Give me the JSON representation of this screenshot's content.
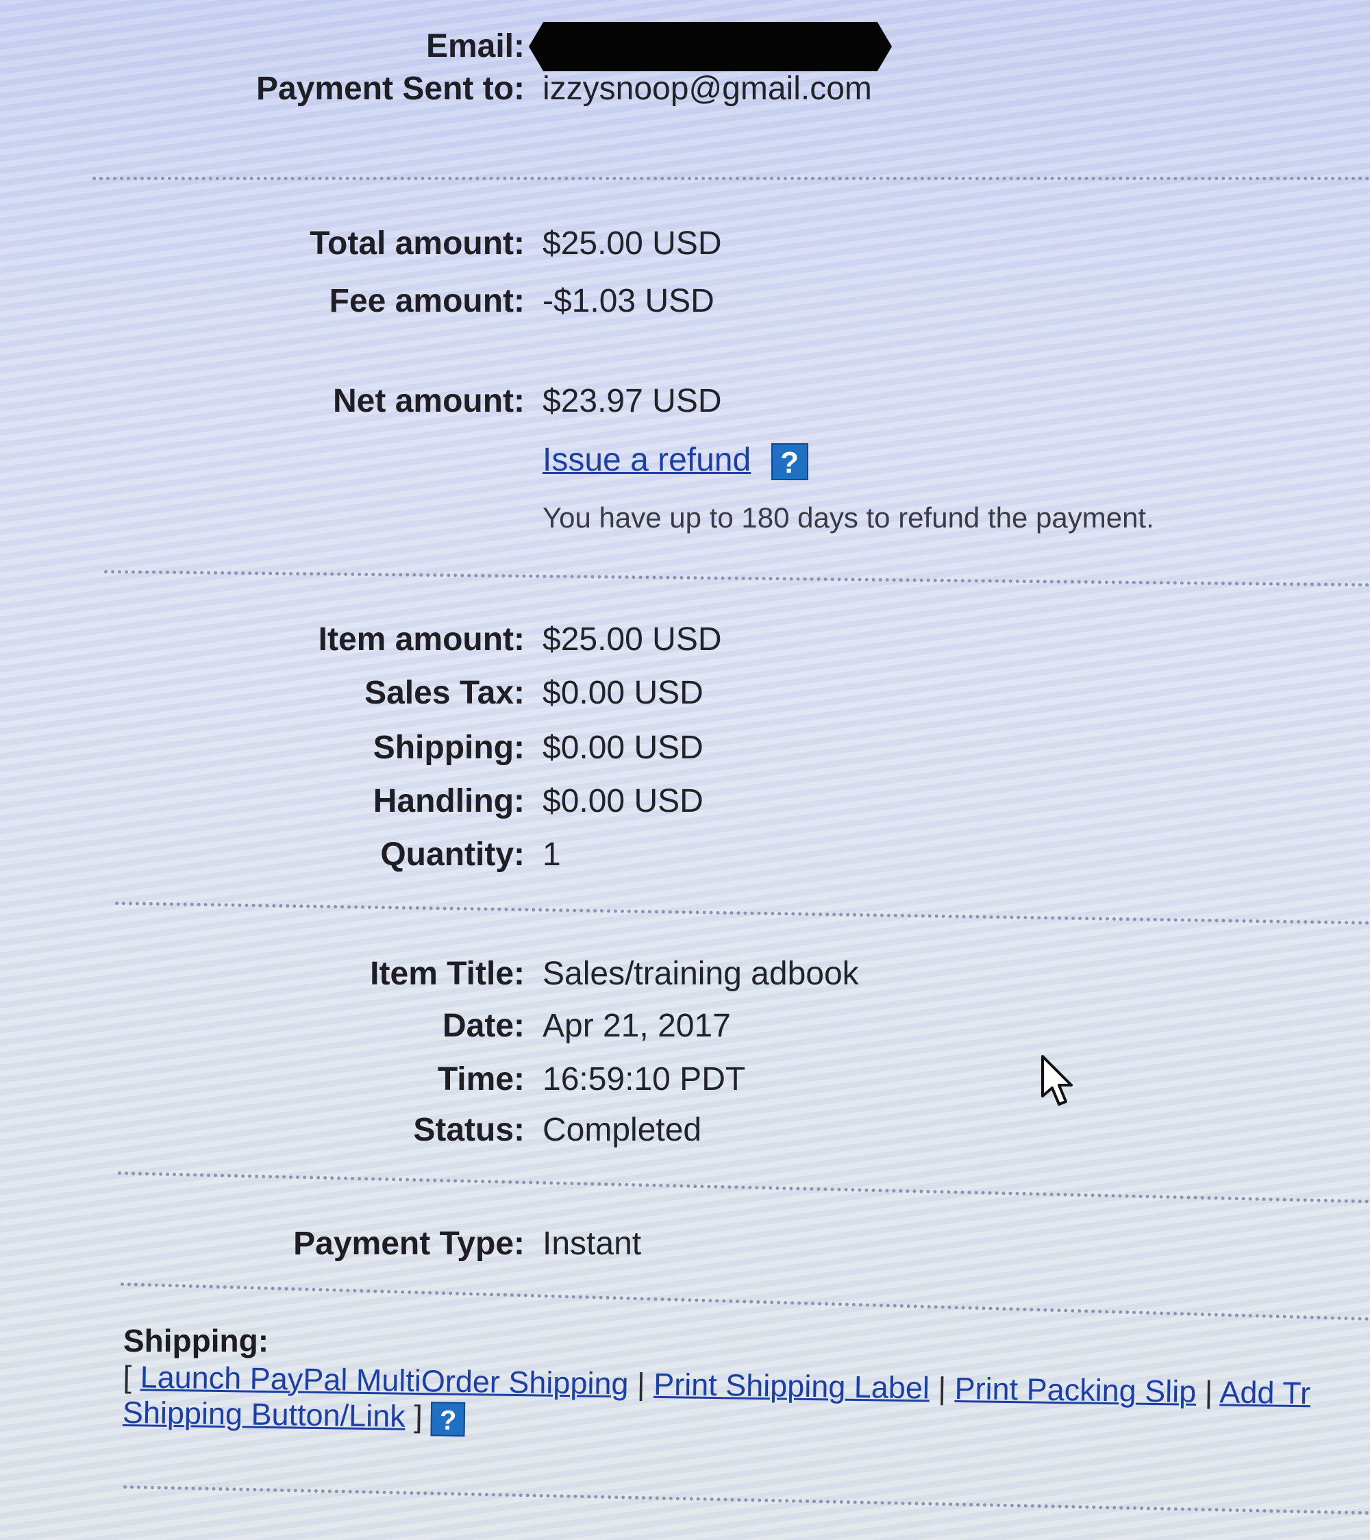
{
  "header": {
    "email_label": "Email:",
    "sent_to_label": "Payment Sent to:",
    "sent_to_value": "izzysnoop@gmail.com"
  },
  "amounts": {
    "total_label": "Total amount:",
    "total_value": "$25.00 USD",
    "fee_label": "Fee amount:",
    "fee_value": "-$1.03 USD",
    "net_label": "Net amount:",
    "net_value": "$23.97 USD",
    "refund_link": "Issue a refund",
    "refund_note": "You have up to 180 days to refund the payment."
  },
  "details": {
    "item_amount_label": "Item amount:",
    "item_amount_value": "$25.00 USD",
    "sales_tax_label": "Sales Tax:",
    "sales_tax_value": "$0.00 USD",
    "shipping_label": "Shipping:",
    "shipping_value": "$0.00 USD",
    "handling_label": "Handling:",
    "handling_value": "$0.00 USD",
    "quantity_label": "Quantity:",
    "quantity_value": "1"
  },
  "item": {
    "title_label": "Item Title:",
    "title_value": "Sales/training adbook",
    "date_label": "Date:",
    "date_value": "Apr 21, 2017",
    "time_label": "Time:",
    "time_value": "16:59:10 PDT",
    "status_label": "Status:",
    "status_value": "Completed"
  },
  "payment": {
    "type_label": "Payment Type:",
    "type_value": "Instant"
  },
  "shipping_section": {
    "title": "Shipping:",
    "open_bracket": "[ ",
    "link_multiorder": "Launch PayPal MultiOrder Shipping",
    "sep": " | ",
    "link_label": "Print Shipping Label",
    "link_packing": "Print Packing Slip",
    "link_add": "Add Tr",
    "link_button": "Shipping Button/Link",
    "close_bracket": " ] "
  },
  "help_glyph": "?",
  "icons": [
    "help-icon",
    "mouse-cursor-icon"
  ],
  "colors": {
    "link": "#1c3fa6",
    "help_icon_bg": "#1f6fc2"
  }
}
